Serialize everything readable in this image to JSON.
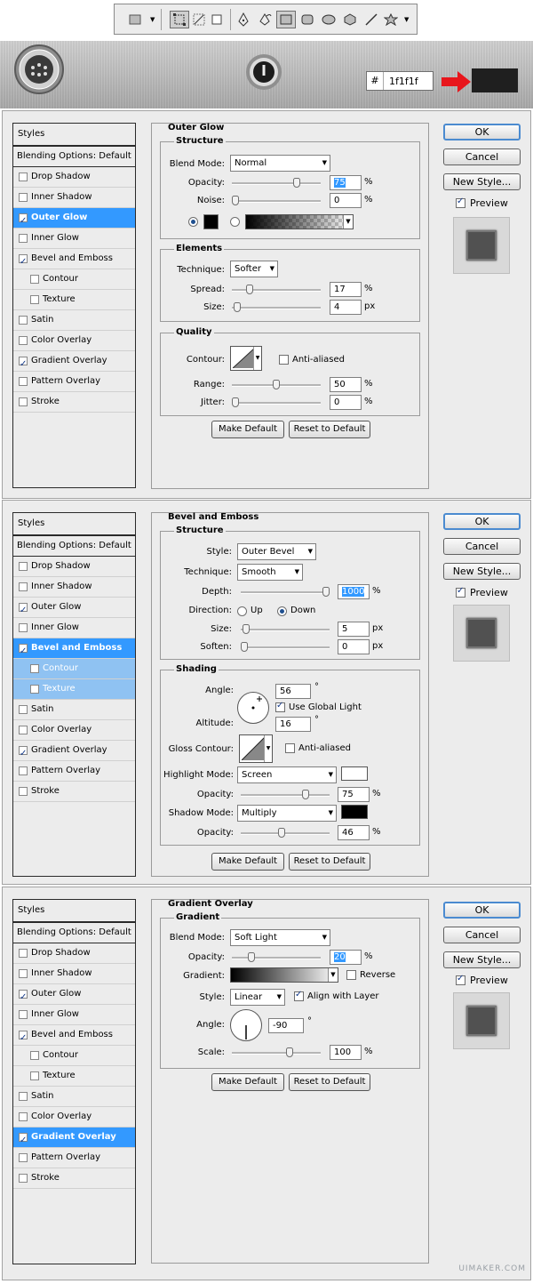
{
  "hex": {
    "hash": "#",
    "value": "1f1f1f",
    "swatch": "#1f1f1f"
  },
  "styles_title": "Styles",
  "blending": "Blending Options: Default",
  "style_items": [
    "Drop Shadow",
    "Inner Shadow",
    "Outer Glow",
    "Inner Glow",
    "Bevel and Emboss",
    "Contour",
    "Texture",
    "Satin",
    "Color Overlay",
    "Gradient Overlay",
    "Pattern Overlay",
    "Stroke"
  ],
  "buttons": {
    "ok": "OK",
    "cancel": "Cancel",
    "new_style": "New Style...",
    "preview": "Preview",
    "make_default": "Make Default",
    "reset_default": "Reset to Default"
  },
  "outer_glow": {
    "title": "Outer Glow",
    "structure": "Structure",
    "blend_mode_label": "Blend Mode:",
    "blend_mode": "Normal",
    "opacity_label": "Opacity:",
    "opacity": "75",
    "opacity_value": 75,
    "noise_label": "Noise:",
    "noise": "0",
    "noise_value": 0,
    "pct": "%",
    "elements": "Elements",
    "technique_label": "Technique:",
    "technique": "Softer",
    "spread_label": "Spread:",
    "spread": "17",
    "spread_value": 17,
    "size_label": "Size:",
    "size": "4",
    "size_value": 4,
    "px": "px",
    "quality": "Quality",
    "contour_label": "Contour:",
    "anti_aliased": "Anti-aliased",
    "range_label": "Range:",
    "range": "50",
    "range_value": 50,
    "jitter_label": "Jitter:",
    "jitter": "0",
    "jitter_value": 0
  },
  "bevel": {
    "title": "Bevel and Emboss",
    "structure": "Structure",
    "style_label": "Style:",
    "style": "Outer Bevel",
    "technique_label": "Technique:",
    "technique": "Smooth",
    "depth_label": "Depth:",
    "depth": "1000",
    "depth_value": 1000,
    "direction_label": "Direction:",
    "up": "Up",
    "down": "Down",
    "size_label": "Size:",
    "size": "5",
    "size_value": 5,
    "soften_label": "Soften:",
    "soften": "0",
    "soften_value": 0,
    "px": "px",
    "pct": "%",
    "shading": "Shading",
    "angle_label": "Angle:",
    "angle": "56",
    "deg": "°",
    "use_global_light": "Use Global Light",
    "altitude_label": "Altitude:",
    "altitude": "16",
    "gloss_label": "Gloss Contour:",
    "anti_aliased": "Anti-aliased",
    "highlight_label": "Highlight Mode:",
    "highlight": "Screen",
    "highlight_color": "#ffffff",
    "hl_opacity_label": "Opacity:",
    "hl_opacity": "75",
    "hl_opacity_value": 75,
    "shadow_label": "Shadow Mode:",
    "shadow": "Multiply",
    "shadow_color": "#000000",
    "sh_opacity_label": "Opacity:",
    "sh_opacity": "46",
    "sh_opacity_value": 46
  },
  "gradient": {
    "title": "Gradient Overlay",
    "section": "Gradient",
    "blend_mode_label": "Blend Mode:",
    "blend_mode": "Soft Light",
    "opacity_label": "Opacity:",
    "opacity": "20",
    "opacity_value": 20,
    "gradient_label": "Gradient:",
    "reverse": "Reverse",
    "style_label": "Style:",
    "style": "Linear",
    "align": "Align with Layer",
    "angle_label": "Angle:",
    "angle": "-90",
    "deg": "°",
    "scale_label": "Scale:",
    "scale": "100",
    "scale_value": 100,
    "pct": "%"
  },
  "watermark": "UIMAKER.COM"
}
